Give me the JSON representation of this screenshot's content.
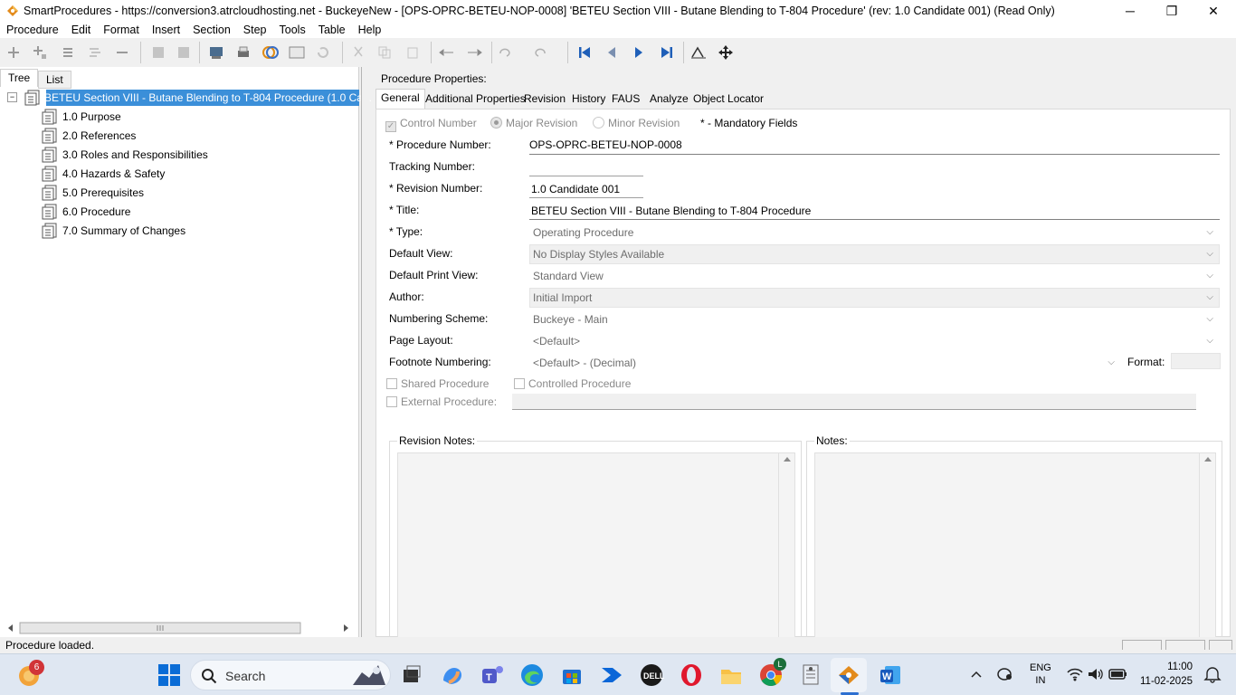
{
  "window": {
    "title": "SmartProcedures - https://conversion3.atrcloudhosting.net - BuckeyeNew - [OPS-OPRC-BETEU-NOP-0008] 'BETEU Section VIII - Butane Blending to T-804 Procedure' (rev: 1.0 Candidate 001) (Read Only)",
    "minimize": "─",
    "restore": "❐",
    "close": "✕"
  },
  "menu": [
    "Procedure",
    "Edit",
    "Format",
    "Insert",
    "Section",
    "Step",
    "Tools",
    "Table",
    "Help"
  ],
  "left_tabs": [
    "Tree",
    "List"
  ],
  "tree": {
    "collapse_glyph": "−",
    "root": "BETEU Section VIII - Butane Blending to T-804 Procedure (1.0 Ca...",
    "children": [
      "1.0 Purpose",
      "2.0 References",
      "3.0 Roles and Responsibilities",
      "4.0 Hazards & Safety",
      "5.0 Prerequisites",
      "6.0 Procedure",
      "7.0 Summary of Changes"
    ]
  },
  "properties": {
    "header": "Procedure Properties:",
    "tabs": [
      "General",
      "Additional Properties",
      "Revision",
      "History",
      "FAUS",
      "Analyze",
      "Object Locator"
    ],
    "control_number": "Control Number",
    "major_revision": "Major Revision",
    "minor_revision": "Minor Revision",
    "mandatory_note": "* - Mandatory Fields",
    "procedure_number_label": "* Procedure Number:",
    "procedure_number": "OPS-OPRC-BETEU-NOP-0008",
    "tracking_number_label": "Tracking Number:",
    "tracking_number": "",
    "revision_number_label": "* Revision Number:",
    "revision_number": "1.0 Candidate 001",
    "title_label": "* Title:",
    "title": "BETEU Section VIII - Butane Blending to T-804 Procedure",
    "type_label": "* Type:",
    "type": "Operating Procedure",
    "default_view_label": "Default View:",
    "default_view": "No Display Styles Available",
    "default_print_view_label": "Default Print View:",
    "default_print_view": "Standard View",
    "author_label": "Author:",
    "author": "Initial Import",
    "numbering_scheme_label": "Numbering Scheme:",
    "numbering_scheme": "Buckeye - Main",
    "page_layout_label": "Page Layout:",
    "page_layout": "<Default>",
    "footnote_numbering_label": "Footnote Numbering:",
    "footnote_numbering": "<Default> - (Decimal)",
    "format_label": "Format:",
    "shared_procedure": "Shared Procedure",
    "controlled_procedure": "Controlled Procedure",
    "external_procedure": "External Procedure:",
    "revision_notes_label": "Revision Notes:",
    "notes_label": "Notes:",
    "dropdown_arrow": "⌵"
  },
  "status": "Procedure loaded.",
  "taskbar": {
    "notification_count": "6",
    "search": "Search",
    "chrome_badge": "L",
    "lang1": "ENG",
    "lang2": "IN",
    "time": "11:00",
    "date": "11-02-2025"
  },
  "colors": {
    "selection": "#3b8fd9",
    "blue_nav": "#1f5fb8"
  }
}
